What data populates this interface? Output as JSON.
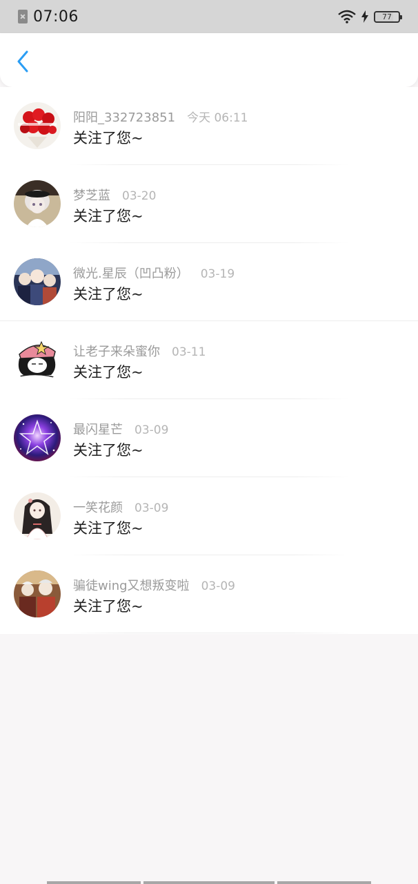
{
  "status_bar": {
    "time": "07:06",
    "battery": "77",
    "icons": [
      "sim-error-icon",
      "wifi-icon",
      "charging-icon",
      "battery-icon"
    ]
  },
  "header": {
    "back_icon": "chevron-left-icon",
    "accent_color": "#2a9df4"
  },
  "notifications": [
    {
      "username": "阳阳_332723851",
      "time": "今天 06:11",
      "action": "关注了您~",
      "avatar": "red-roses-avatar"
    },
    {
      "username": "梦芝蓝",
      "time": "03-20",
      "action": "关注了您~",
      "avatar": "anime-girl-avatar"
    },
    {
      "username": "微光.星辰（凹凸粉）",
      "time": "03-19",
      "action": "关注了您~",
      "avatar": "anime-group-avatar"
    },
    {
      "username": "让老子来朵蜜你",
      "time": "03-11",
      "action": "关注了您~",
      "avatar": "cartoon-star-hat-avatar"
    },
    {
      "username": "最闪星芒",
      "time": "03-09",
      "action": "关注了您~",
      "avatar": "galaxy-star-avatar"
    },
    {
      "username": "一笑花颜",
      "time": "03-09",
      "action": "关注了您~",
      "avatar": "hanfu-girl-avatar"
    },
    {
      "username": "骗徒wing又想叛变啦",
      "time": "03-09",
      "action": "关注了您~",
      "avatar": "anime-characters-avatar"
    }
  ]
}
